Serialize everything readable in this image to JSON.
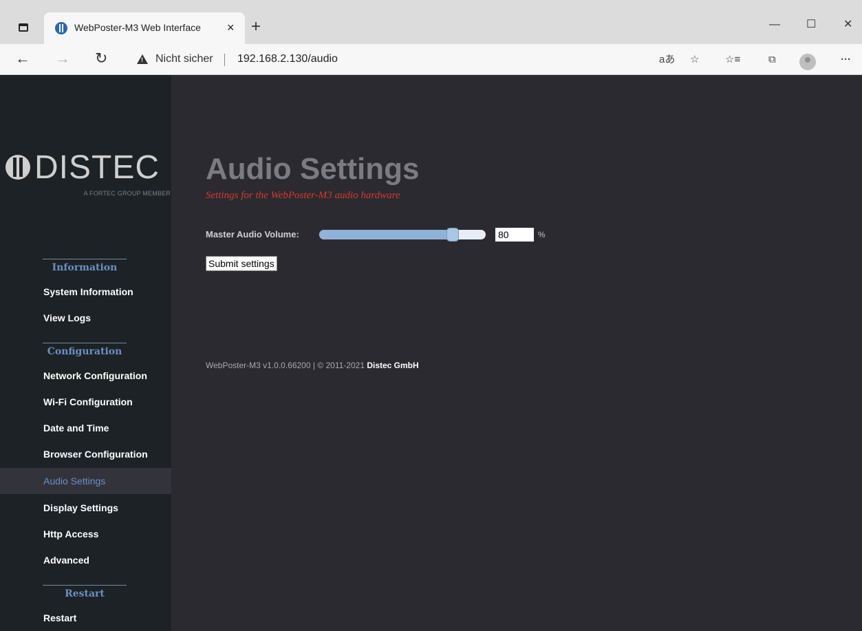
{
  "browser": {
    "tab_title": "WebPoster-M3 Web Interface",
    "new_tab": "+",
    "tab_close": "×",
    "win_min": "—",
    "win_max": "☐",
    "win_close": "✕",
    "nav_back": "←",
    "nav_forward": "→",
    "nav_refresh": "↻",
    "not_secure": "Nicht sicher",
    "url": "192.168.2.130/audio",
    "read_aloud": "aあ",
    "add_favorite": "☆",
    "favorites": "☆≡",
    "collections": "⧉",
    "more": "···"
  },
  "sidebar": {
    "logo_text": "DISTEC",
    "logo_sub": "A FORTEC GROUP MEMBER",
    "sections": {
      "information": "Information",
      "configuration": "Configuration",
      "restart": "Restart"
    },
    "items": [
      "System Information",
      "View Logs",
      "Network Configuration",
      "Wi-Fi Configuration",
      "Date and Time",
      "Browser Configuration",
      "Audio Settings",
      "Display Settings",
      "Http Access",
      "Advanced",
      "Restart"
    ],
    "active_item": "Audio Settings"
  },
  "main": {
    "title": "Audio Settings",
    "subtitle": "Settings for the WebPoster-M3 audio hardware",
    "volume_label": "Master Audio Volume:",
    "volume_value": "80",
    "volume_percent": 80,
    "volume_unit": "%",
    "submit_label": "Submit settings",
    "footer_text": "WebPoster-M3 v1.0.0.66200 | © 2011-2021 ",
    "footer_company": "Distec GmbH"
  },
  "colors": {
    "sidebar_bg": "#1c2225",
    "main_bg": "#2c2a31",
    "accent": "#6d8fc4",
    "subtitle": "#d43a2c"
  }
}
